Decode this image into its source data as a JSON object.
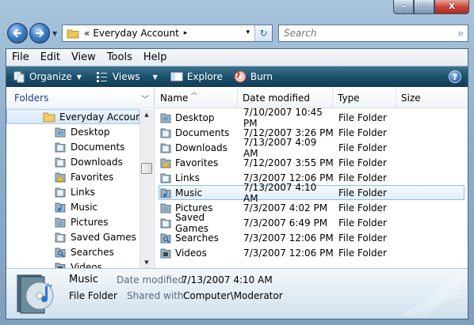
{
  "window": {
    "caption_buttons": {
      "minimize": "–",
      "maximize": "□",
      "close": "X"
    }
  },
  "address": {
    "overflow": "«",
    "crumb": "Everyday Account",
    "separator": "▸",
    "dropdown": "▾",
    "refresh": "↻"
  },
  "search": {
    "placeholder": "Search",
    "icon": "search-icon"
  },
  "menu": {
    "file": "File",
    "edit": "Edit",
    "view": "View",
    "tools": "Tools",
    "help": "Help"
  },
  "commands": {
    "organize": "Organize",
    "views": "Views",
    "explore": "Explore",
    "burn": "Burn",
    "help_symbol": "?"
  },
  "navpane": {
    "header": "Folders",
    "root": "Everyday Account",
    "items": [
      {
        "label": "Desktop",
        "icon": "desktop-folder-icon"
      },
      {
        "label": "Documents",
        "icon": "documents-folder-icon"
      },
      {
        "label": "Downloads",
        "icon": "downloads-folder-icon"
      },
      {
        "label": "Favorites",
        "icon": "favorites-folder-icon"
      },
      {
        "label": "Links",
        "icon": "links-folder-icon"
      },
      {
        "label": "Music",
        "icon": "music-folder-icon"
      },
      {
        "label": "Pictures",
        "icon": "pictures-folder-icon"
      },
      {
        "label": "Saved Games",
        "icon": "saved-games-folder-icon"
      },
      {
        "label": "Searches",
        "icon": "searches-folder-icon"
      },
      {
        "label": "Videos",
        "icon": "videos-folder-icon"
      }
    ]
  },
  "list": {
    "columns": {
      "name": "Name",
      "date": "Date modified",
      "type": "Type",
      "size": "Size"
    },
    "rows": [
      {
        "name": "Desktop",
        "date": "7/10/2007 10:45 PM",
        "type": "File Folder"
      },
      {
        "name": "Documents",
        "date": "7/12/2007 3:26 PM",
        "type": "File Folder"
      },
      {
        "name": "Downloads",
        "date": "7/13/2007 4:09 AM",
        "type": "File Folder"
      },
      {
        "name": "Favorites",
        "date": "7/12/2007 3:55 PM",
        "type": "File Folder"
      },
      {
        "name": "Links",
        "date": "7/3/2007 12:06 PM",
        "type": "File Folder"
      },
      {
        "name": "Music",
        "date": "7/13/2007 4:10 AM",
        "type": "File Folder",
        "selected": true
      },
      {
        "name": "Pictures",
        "date": "7/3/2007 4:02 PM",
        "type": "File Folder"
      },
      {
        "name": "Saved Games",
        "date": "7/3/2007 6:49 PM",
        "type": "File Folder"
      },
      {
        "name": "Searches",
        "date": "7/3/2007 12:06 PM",
        "type": "File Folder"
      },
      {
        "name": "Videos",
        "date": "7/3/2007 12:06 PM",
        "type": "File Folder"
      }
    ]
  },
  "details": {
    "name": "Music",
    "type": "File Folder",
    "modified_label": "Date modified:",
    "modified_value": "7/13/2007 4:10 AM",
    "shared_label": "Shared with:",
    "shared_value": "Computer\\Moderator"
  },
  "colors": {
    "command_bar": "#1c506c",
    "selection": "#e3effb",
    "nav_header_text": "#1e3b8a"
  }
}
